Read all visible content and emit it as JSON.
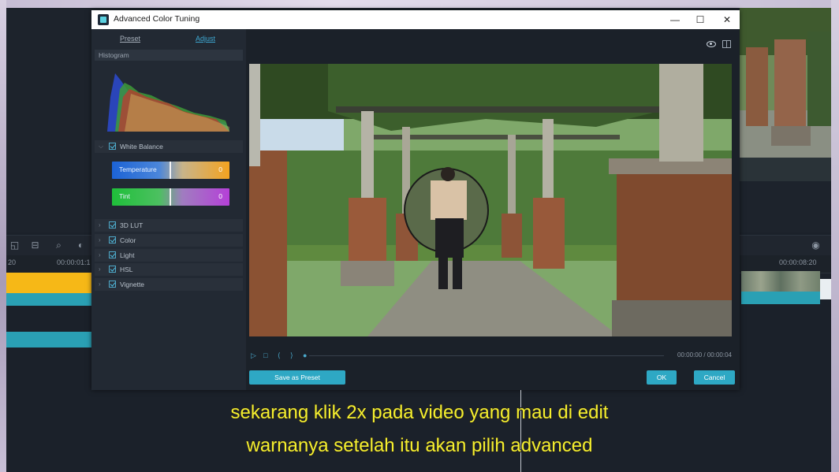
{
  "dialog": {
    "title": "Advanced Color Tuning",
    "window_controls": {
      "minimize": "—",
      "maximize": "☐",
      "close": "✕"
    }
  },
  "panel": {
    "tabs": [
      {
        "label": "Preset"
      },
      {
        "label": "Adjust"
      }
    ],
    "active_tab": "Adjust",
    "histogram_label": "Histogram",
    "white_balance": {
      "label": "White Balance",
      "checked": true,
      "temperature": {
        "label": "Temperature",
        "value": "0"
      },
      "tint": {
        "label": "Tint",
        "value": "0"
      }
    },
    "sections": [
      {
        "label": "3D LUT",
        "checked": true
      },
      {
        "label": "Color",
        "checked": true
      },
      {
        "label": "Light",
        "checked": true
      },
      {
        "label": "HSL",
        "checked": true
      },
      {
        "label": "Vignette",
        "checked": true
      }
    ]
  },
  "playback": {
    "time": "00:00:00 / 00:00:04",
    "progress": 0
  },
  "buttons": {
    "save_preset": "Save as Preset",
    "ok": "OK",
    "cancel": "Cancel"
  },
  "timeline": {
    "time_left": "20",
    "time_mid": "00:00:01:1",
    "time_right": "00:00:08:20"
  },
  "subtitles": [
    "sekarang klik 2x pada video yang mau di edit",
    "warnanya setelah itu akan pilih advanced"
  ],
  "colors": {
    "accent": "#2ea8c4",
    "subtitle": "#f5ef2e",
    "track_yellow": "#f6b817",
    "track_cyan": "#2aa0b4"
  }
}
